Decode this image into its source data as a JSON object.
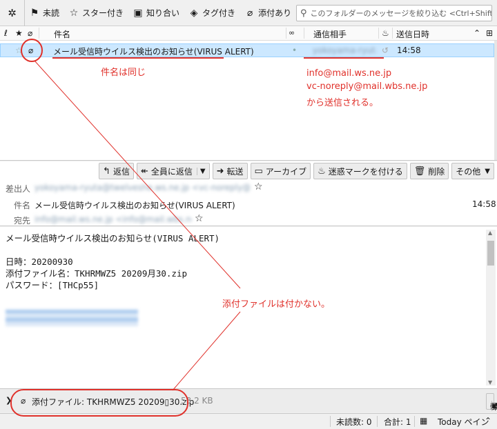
{
  "quick_filter": {
    "unread": "未読",
    "starred": "スター付き",
    "contacts": "知り合い",
    "tagged": "タグ付き",
    "attachment": "添付あり",
    "search_placeholder": "このフォルダーのメッセージを絞り込む <Ctrl+Shift+K>"
  },
  "columns": {
    "subject": "件名",
    "correspondent": "通信相手",
    "date": "送信日時"
  },
  "message_row": {
    "subject": "メール受信時ウイルス検出のお知らせ(VIRUS ALERT)",
    "correspondent": "yokoyama-ryuta@ws-ne.jp",
    "date": "14:58"
  },
  "toolbar": {
    "reply": "返信",
    "reply_all": "全員に返信",
    "forward": "転送",
    "archive": "アーカイブ",
    "junk": "迷惑マークを付ける",
    "delete": "削除",
    "other": "その他"
  },
  "header": {
    "from_label": "差出人",
    "from_value": "yokoyama-ryuta@twelveshe.ws.ne.jp <vc-noreply@kagaku.ws.ne.jp>",
    "subject_label": "件名",
    "subject_value": "メール受信時ウイルス検出のお知らせ(VIRUS ALERT)",
    "date": "14:58",
    "to_label": "宛先",
    "to_value": "info@mail.ws.ne.jp <info@mail.wbs.ne.jp>"
  },
  "body": {
    "text": "メール受信時ウイルス検出のお知らせ(VIRUS ALERT)\n\n日時：20200930\n添付ファイル名：TKHRMWZ5 20209月30.zip\nパスワード：[THCp55]",
    "link": "https://example-download.ws.ne.jp/file"
  },
  "attachment": {
    "label": "添付ファイル: TKHRMWZ5 20209▯30.zip",
    "size": "53.2 KB",
    "save": "保存"
  },
  "status": {
    "unread": "未読数: 0",
    "total": "合計: 1",
    "today_pane": "Today ペイン"
  },
  "annotations": {
    "same_subject": "件名は同じ",
    "sender1": "info@mail.ws.ne.jp",
    "sender2": "vc-noreply@mail.wbs.ne.jp",
    "sent_from": "から送信される。",
    "no_attachment": "添付ファイルは付かない。"
  },
  "colors": {
    "selection": "#cce8ff",
    "annotation": "#e0302a"
  }
}
